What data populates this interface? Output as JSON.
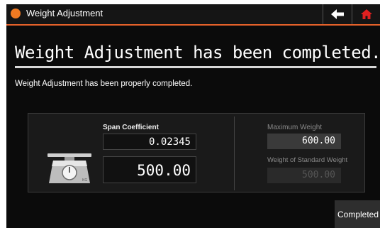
{
  "titlebar": {
    "title": "Weight Adjustment",
    "accent_color": "#e5622a",
    "back_icon": "arrow-left-icon",
    "home_icon": "home-icon",
    "home_icon_color": "#e02020"
  },
  "main": {
    "heading": "Weight Adjustment has been completed.",
    "subtitle": "Weight Adjustment has been properly completed."
  },
  "panel": {
    "span_coefficient": {
      "label": "Span Coefficient",
      "value": "0.02345"
    },
    "weight_display": "500.00",
    "scale_icon": "weighing-scale-icon",
    "scale_icon_text": "KG",
    "maximum_weight": {
      "label": "Maximum Weight",
      "value": "600.00"
    },
    "standard_weight": {
      "label": "Weight of Standard Weight",
      "value": "500.00"
    }
  },
  "footer": {
    "completed_label": "Completed"
  }
}
